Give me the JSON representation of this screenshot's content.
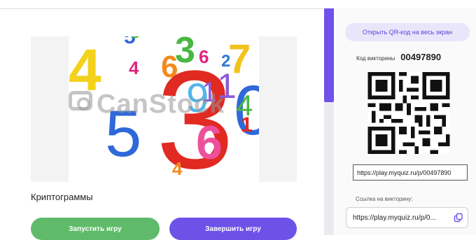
{
  "game": {
    "title": "Криптограммы",
    "cover_watermark": "CanStock",
    "cover_digits": [
      "5",
      "4",
      "6",
      "3",
      "2",
      "4",
      "6",
      "3",
      "7",
      "1",
      "9",
      "1",
      "0",
      "4",
      "5",
      "6",
      "1",
      "4",
      "3"
    ]
  },
  "actions": {
    "start_label": "Запустить игру",
    "end_label": "Завершить игру"
  },
  "side": {
    "fullscreen_qr_label": "Открыть QR-код на весь экран",
    "quiz_code_label": "Код викторины",
    "quiz_code": "00497890",
    "qr_url": "https://play.myquiz.ru/p/00497890",
    "link_label": "Ссылка на викторину:",
    "link_value": "https://play.myquiz.ru/p/0..."
  },
  "colors": {
    "start_button": "#5fbb69",
    "end_button": "#6d52e8",
    "accent": "#7050ea"
  }
}
